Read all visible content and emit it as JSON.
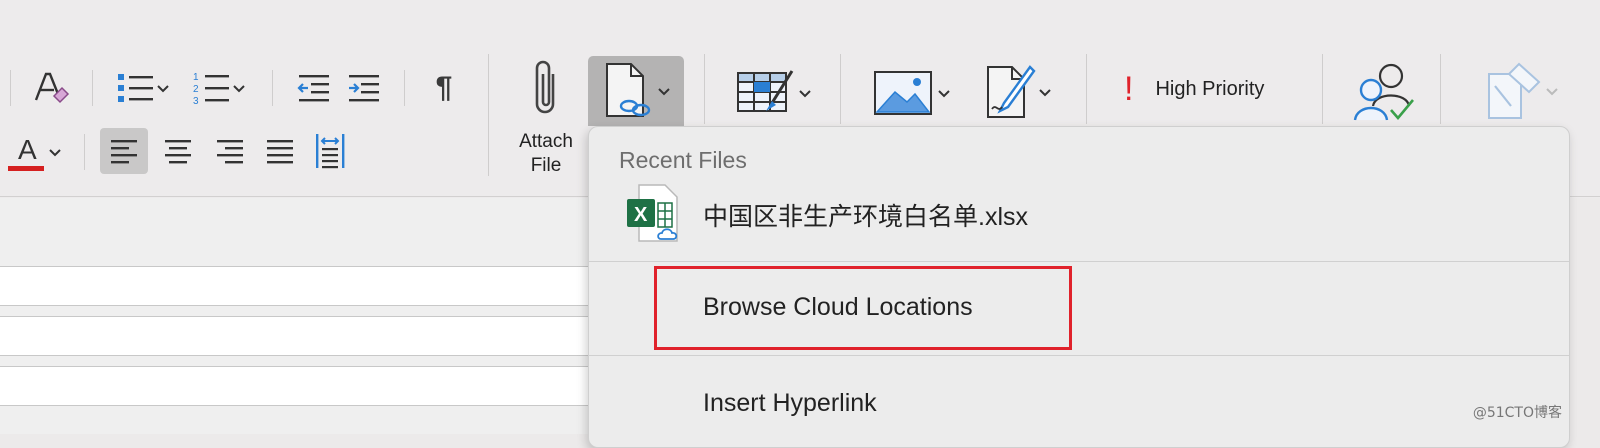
{
  "ribbon": {
    "attach_file_label_line1": "Attach",
    "attach_file_label_line2": "File",
    "high_priority_label": "High Priority",
    "priority_mark": "!",
    "paragraph_mark": "¶",
    "numbered_list_digits": [
      "1",
      "2",
      "3"
    ],
    "font_color_letter": "A"
  },
  "dropdown": {
    "header": "Recent Files",
    "recent_files": [
      {
        "name": "中国区非生产环境白名单.xlsx",
        "icon": "excel-cloud-file-icon",
        "badge": "X"
      }
    ],
    "browse_label": "Browse Cloud Locations",
    "insert_hyperlink_label": "Insert Hyperlink"
  },
  "watermark": "@51CTO博客",
  "colors": {
    "accent_blue": "#2a7fd4",
    "highlight_red": "#e0222b",
    "priority_red": "#e0222b",
    "font_color_red": "#d52020",
    "excel_green": "#1e7145"
  }
}
